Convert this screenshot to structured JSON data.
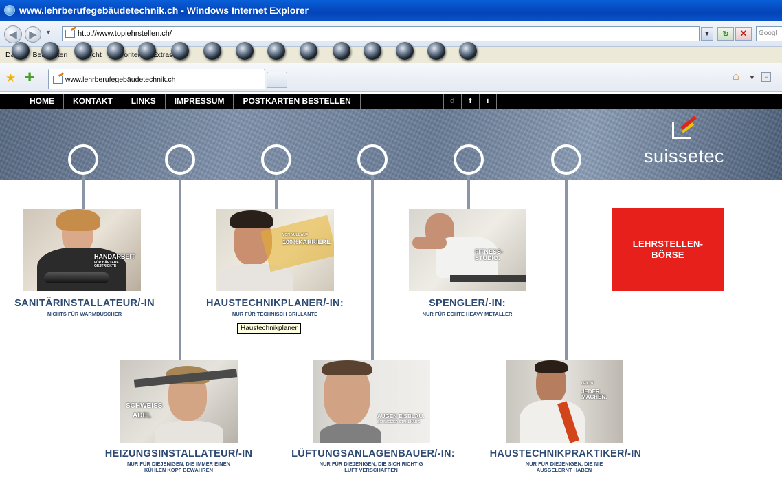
{
  "browser": {
    "window_title": "www.lehrberufegebäudetechnik.ch - Windows Internet Explorer",
    "url": "http://www.topiehrstellen.ch/",
    "search_placeholder": "Googl",
    "menu": [
      "Datei",
      "Bearbeiten",
      "Ansicht",
      "Favoriten",
      "Extras",
      "?"
    ],
    "tab_title": "www.lehrberufegebäudetechnik.ch"
  },
  "site": {
    "nav": [
      "HOME",
      "KONTAKT",
      "LINKS",
      "IMPRESSUM",
      "POSTKARTEN BESTELLEN"
    ],
    "social": [
      "d",
      "f",
      "i"
    ],
    "logo": "suissetec",
    "boerse": {
      "line1": "LEHRSTELLEN-",
      "line2": "BÖRSE"
    },
    "tooltip": "Haustechnikplaner",
    "jobs": [
      {
        "title": "SANITÄRINSTALLATEUR/-IN",
        "sub1": "NICHTS FÜR WARMDUSCHER",
        "sub2": "",
        "photo_text": "HANDARBEIT",
        "photo_sub": "FÜR HÄRTERE GESTRICKTE"
      },
      {
        "title": "HAUSTECHNIKPLANER/-IN:",
        "sub1": "NUR FÜR TECHNISCH BRILLANTE",
        "sub2": "",
        "photo_text": "100%KARRIERE",
        "photo_sub": "VON NULL AUF"
      },
      {
        "title": "SPENGLER/-IN:",
        "sub1": "NUR FÜR ECHTE HEAVY METALLER",
        "sub2": "",
        "photo_text": "FITNESS-STUDIO.",
        "photo_sub": ""
      },
      {
        "title": "HEIZUNGSINSTALLATEUR/-IN",
        "sub1": "NUR FÜR DIEJENIGEN, DIE IMMER EINEN",
        "sub2": "KÜHLEN KOPF BEWAHREN",
        "photo_text": "SCHWEISS",
        "photo_sub": "ADEL"
      },
      {
        "title": "LÜFTUNGSANLAGENBAUER/-IN:",
        "sub1": "NUR FÜR DIEJENIGEN, DIE SICH RICHTIG",
        "sub2": "LUFT VERSCHAFFEN",
        "photo_text": "AUGEN EISBLAU.",
        "photo_sub": "SCHWEIZER STAHLHART."
      },
      {
        "title": "HAUSTECHNIKPRAKTIKER/-IN",
        "sub1": "NUR FÜR DIEJENIGEN, DIE NIE",
        "sub2": "AUSGELERNT HABEN",
        "photo_text": "JEDER MACHEN.",
        "photo_sub": "LEICHT"
      }
    ]
  },
  "colors": {
    "accent_red": "#e8201c",
    "title_blue": "#2e4a73",
    "nav_black": "#000000"
  },
  "icons": [
    "ie-logo-icon",
    "back-arrow-icon",
    "forward-arrow-icon",
    "page-icon",
    "refresh-icon",
    "stop-icon",
    "favorites-star-icon",
    "add-favorite-icon",
    "home-icon",
    "feed-icon",
    "suissetec-logo-icon"
  ]
}
